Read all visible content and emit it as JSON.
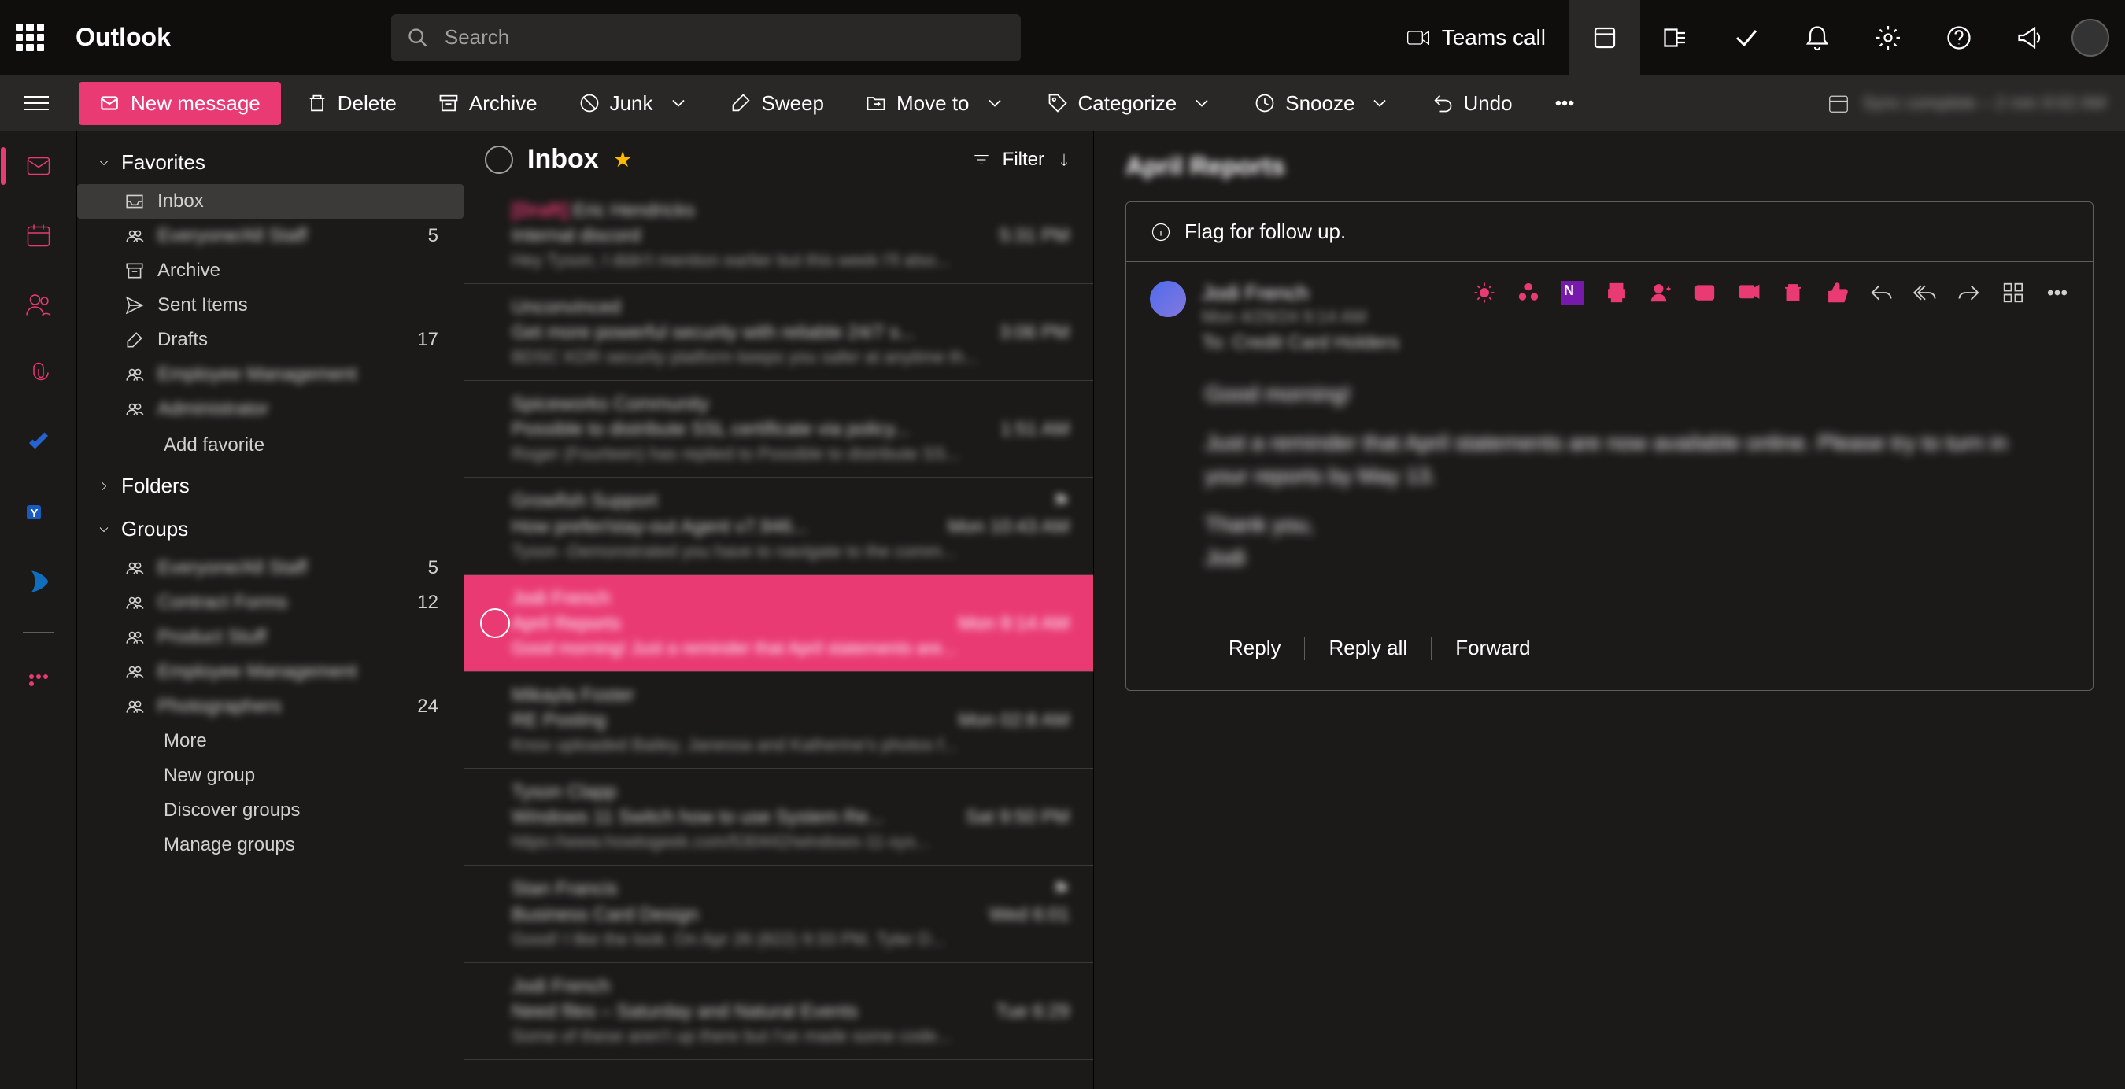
{
  "header": {
    "app_title": "Outlook",
    "search_placeholder": "Search",
    "teams_call": "Teams call",
    "sync_text": "Sync complete – 2 min\n9:02 AM"
  },
  "toolbar": {
    "new_message": "New message",
    "delete": "Delete",
    "archive": "Archive",
    "junk": "Junk",
    "sweep": "Sweep",
    "move_to": "Move to",
    "categorize": "Categorize",
    "snooze": "Snooze",
    "undo": "Undo"
  },
  "sections": {
    "favorites": "Favorites",
    "folders": "Folders",
    "groups": "Groups",
    "add_favorite": "Add favorite",
    "more": "More",
    "new_group": "New group",
    "discover_groups": "Discover groups",
    "manage_groups": "Manage groups"
  },
  "fav_folders": [
    {
      "name": "Inbox",
      "icon": "inbox",
      "count": ""
    },
    {
      "name": "Everyone/All Staff",
      "icon": "group",
      "count": "5",
      "blur": true
    },
    {
      "name": "Archive",
      "icon": "archive",
      "count": ""
    },
    {
      "name": "Sent Items",
      "icon": "sent",
      "count": ""
    },
    {
      "name": "Drafts",
      "icon": "draft",
      "count": "17"
    },
    {
      "name": "Employee Management",
      "icon": "group",
      "count": "",
      "blur": true
    },
    {
      "name": "Administrator",
      "icon": "group",
      "count": "",
      "blur": true
    }
  ],
  "group_folders": [
    {
      "name": "Everyone/All Staff",
      "count": "5"
    },
    {
      "name": "Contract Forms",
      "count": "12"
    },
    {
      "name": "Product Stuff",
      "count": ""
    },
    {
      "name": "Employee Management",
      "count": ""
    },
    {
      "name": "Photographers",
      "count": "24"
    }
  ],
  "list": {
    "title": "Inbox",
    "filter": "Filter"
  },
  "messages": [
    {
      "from": "Eric Hendricks",
      "subject": "Internal discord",
      "time": "5:31 PM",
      "preview": "Hey Tyson, I didn't mention earlier but this week I'll also...",
      "draft": true
    },
    {
      "from": "Unconvinced",
      "subject": "Get more powerful security with reliable 24/7 s...",
      "time": "3:06 PM",
      "preview": "BDSC KDR security platform keeps you safer at anytime th..."
    },
    {
      "from": "Spiceworks Community",
      "subject": "Possible to distribute SSL certificate via policy...",
      "time": "1:51 AM",
      "preview": "Roger (Fourteen) has replied to Possible to distribute SS..."
    },
    {
      "from": "Growfish Support",
      "subject": "How prefer/stay-out Agent v7.946...",
      "time": "Mon 10:43 AM",
      "preview": "Tyson -Demonstrated you have to navigate to the comm...",
      "flagr": true
    },
    {
      "from": "Jodi French",
      "subject": "April Reports",
      "time": "Mon 9:14 AM",
      "preview": "Good morning! Just a reminder that April statements are...",
      "selected": true,
      "flag": true
    },
    {
      "from": "Mikayla Foster",
      "subject": "RE Posting",
      "time": "Mon 02:8 AM",
      "preview": "Knox uploaded Bailey, Janessa and Katherine's photos f..."
    },
    {
      "from": "Tyson Clapp",
      "subject": "Windows 11 Switch how to use System Re...",
      "time": "Sat 9:50 PM",
      "preview": "https://www.howtogeek.com/530442/windows-11-sys..."
    },
    {
      "from": "Stan Francis",
      "subject": "Business Card Design",
      "time": "Wed 6:01",
      "preview": "Good! I like the look. On Apr 26 (822) 9:33 PM, Tyler D...",
      "flagr": true
    },
    {
      "from": "Jodi French",
      "subject": "Need files – Saturday and Natural Events",
      "time": "Tue 6:29",
      "preview": "Some of these aren't up there but I've made some code..."
    }
  ],
  "reading": {
    "subject": "April Reports",
    "flag_banner": "Flag for follow up.",
    "sender_name": "Jodi French",
    "sender_date": "Mon 4/29/24 9:14 AM",
    "sender_to": "To: Credit Card Holders",
    "body_greeting": "Good morning!",
    "body_main": "Just a reminder that April statements are now available online.  Please try to turn in your reports by May 13.",
    "body_thanks": "Thank you,",
    "body_sign": "Jodi",
    "reply": "Reply",
    "reply_all": "Reply all",
    "forward": "Forward"
  }
}
